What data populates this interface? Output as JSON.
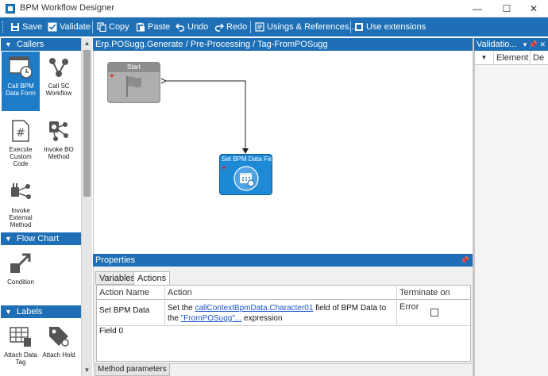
{
  "window": {
    "title": "BPM Workflow Designer",
    "minimize_glyph": "—",
    "maximize_glyph": "☐",
    "close_glyph": "✕"
  },
  "toolbar": {
    "save": "Save",
    "validate": "Validate",
    "copy": "Copy",
    "paste": "Paste",
    "undo": "Undo",
    "redo": "Redo",
    "usings": "Usings & References...",
    "use_extensions": "Use extensions"
  },
  "palette": {
    "categories": [
      {
        "label": "Callers",
        "tools": [
          {
            "label": "Call BPM Data Form",
            "icon": "form-clock-icon",
            "selected": true
          },
          {
            "label": "Call SC Workflow",
            "icon": "nodes-icon"
          },
          {
            "label": "Execute Custom Code",
            "icon": "hash-document-icon"
          },
          {
            "label": "Invoke BO Method",
            "icon": "gear-network-icon"
          },
          {
            "label": "Invoke External Method",
            "icon": "plug-network-icon"
          }
        ]
      },
      {
        "label": "Flow Chart",
        "tools": [
          {
            "label": "Condition",
            "icon": "diagonal-arrow-icon"
          }
        ]
      },
      {
        "label": "Labels",
        "tools": [
          {
            "label": "Attach Data Tag",
            "icon": "tag-grid-icon"
          },
          {
            "label": "Attach Hold",
            "icon": "tag-hold-icon"
          }
        ]
      }
    ]
  },
  "breadcrumb": "Erp.POSugg.Generate / Pre-Processing / Tag-FromPOSugg",
  "canvas": {
    "nodes": [
      {
        "title": "Start",
        "icon": "flag-icon"
      },
      {
        "title": "Set BPM Data Field",
        "icon": "calendar-gear-icon"
      }
    ]
  },
  "properties": {
    "title": "Properties",
    "tabs": [
      "Variables",
      "Actions"
    ],
    "active_tab": "Actions",
    "columns": [
      "Action Name",
      "Action",
      "Terminate on Error"
    ],
    "rows": [
      {
        "action_name": "Set BPM Data Field 0",
        "action_prefix": "Set the ",
        "action_link1": "callContextBpmData.Character01",
        "action_middle": " field of BPM Data to the ",
        "action_link2": "\"FromPOSugg\"...",
        "action_suffix": " expression",
        "terminate_on_error": false
      }
    ]
  },
  "method_parameters_tab": "Method parameters",
  "validation": {
    "title": "Validatio...",
    "columns": [
      "Element",
      "De"
    ]
  }
}
